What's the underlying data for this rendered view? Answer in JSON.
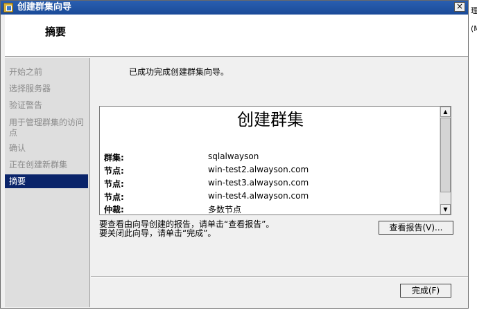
{
  "window": {
    "title": "创建群集向导",
    "close_label": "×"
  },
  "header": {
    "title": "摘要"
  },
  "sidebar": {
    "steps": [
      {
        "label": "开始之前"
      },
      {
        "label": "选择服务器"
      },
      {
        "label": "验证警告"
      },
      {
        "label": "用于管理群集的访问点"
      },
      {
        "label": "确认"
      },
      {
        "label": "正在创建新群集"
      },
      {
        "label": "摘要"
      }
    ]
  },
  "main": {
    "message": "已成功完成创建群集向导。",
    "report": {
      "title": "创建群集",
      "rows": [
        {
          "label": "群集:",
          "value": "sqlalwayson"
        },
        {
          "label": "节点:",
          "value": "win-test2.alwayson.com"
        },
        {
          "label": "节点:",
          "value": "win-test3.alwayson.com"
        },
        {
          "label": "节点:",
          "value": "win-test4.alwayson.com"
        },
        {
          "label": "仲裁:",
          "value": "多数节点"
        }
      ],
      "scroll_up": "▲",
      "scroll_down": "▼"
    },
    "hint_line1": "要查看由向导创建的报告，请单击“查看报告”。",
    "hint_line2": "要关闭此向导，请单击“完成”。",
    "view_report_button": "查看报告(V)...",
    "finish_button": "完成(F)"
  },
  "background": {
    "fragment1": "理",
    "fragment2": "(M"
  },
  "colors": {
    "titlebar": "#1a4a98",
    "selected_step": "#0a246a"
  }
}
